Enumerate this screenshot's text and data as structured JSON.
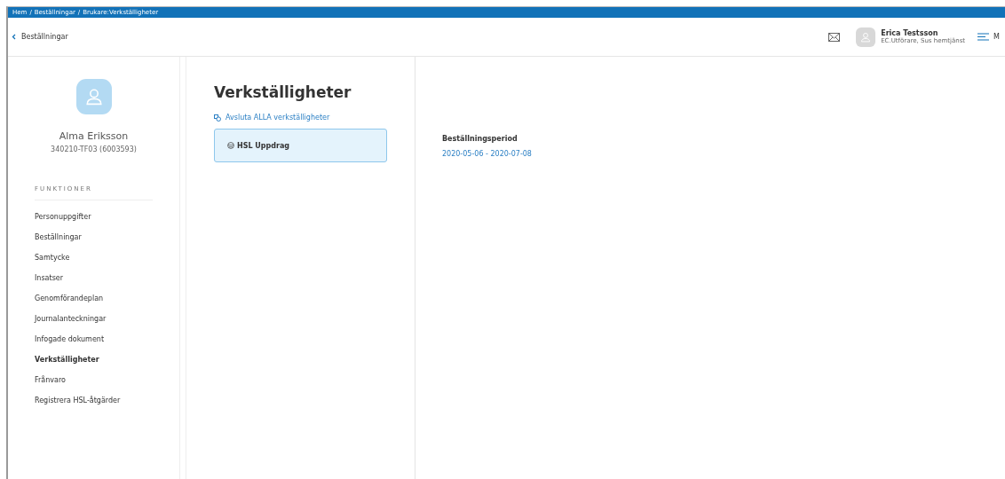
{
  "breadcrumb": [
    "Hem",
    "Beställningar",
    "Brukare:Verkställigheter"
  ],
  "breadcrumb_separator": "/",
  "back_link": "Beställningar",
  "user": {
    "name": "Erica Testsson",
    "role": "EC.Utförare, Sus hemtjänst"
  },
  "menu_label": "M",
  "client": {
    "name": "Alma Eriksson",
    "id": "340210-TF03 (6003593)"
  },
  "functions_heading": "FUNKTIONER",
  "sidebar_items": [
    {
      "label": "Personuppgifter",
      "selected": false
    },
    {
      "label": "Beställningar",
      "selected": false
    },
    {
      "label": "Samtycke",
      "selected": false
    },
    {
      "label": "Insatser",
      "selected": false
    },
    {
      "label": "Genomförandeplan",
      "selected": false
    },
    {
      "label": "Journalanteckningar",
      "selected": false
    },
    {
      "label": "Infogade dokument",
      "selected": false
    },
    {
      "label": "Verkställigheter",
      "selected": true
    },
    {
      "label": "Frånvaro",
      "selected": false
    },
    {
      "label": "Registrera HSL-åtgärder",
      "selected": false
    }
  ],
  "page_title": "Verkställigheter",
  "close_all_link": "Avsluta ALLA verkställigheter",
  "assignments": [
    {
      "label": "HSL Uppdrag",
      "selected": true
    }
  ],
  "detail": {
    "label": "Beställningsperiod",
    "value": "2020-05-06 - 2020-07-08"
  }
}
